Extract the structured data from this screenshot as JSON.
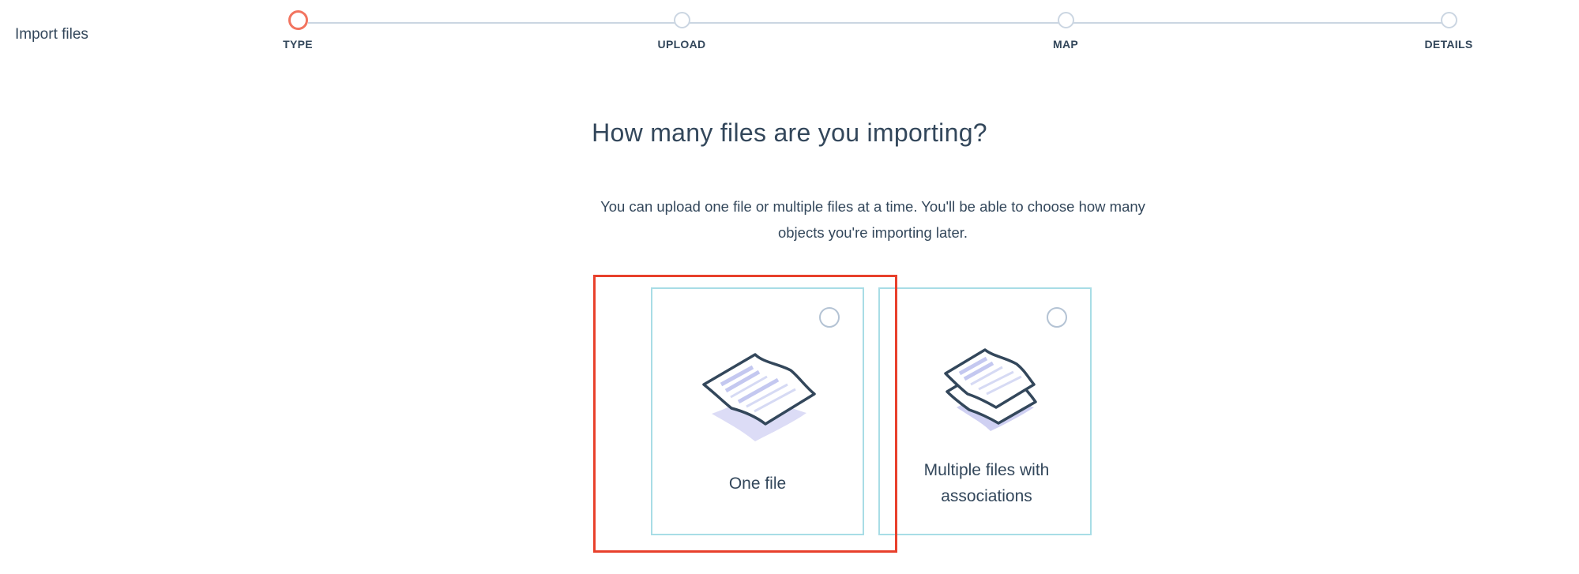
{
  "header": {
    "title": "Import files"
  },
  "stepper": {
    "steps": [
      {
        "label": "TYPE",
        "state": "active"
      },
      {
        "label": "UPLOAD",
        "state": "pending"
      },
      {
        "label": "MAP",
        "state": "pending"
      },
      {
        "label": "DETAILS",
        "state": "pending"
      }
    ],
    "active_color": "#f2745f",
    "inactive_color": "#cbd6e2"
  },
  "main": {
    "question": "How many files are you importing?",
    "description": "You can upload one file or multiple files at a time. You'll be able to choose how many objects you're importing later.",
    "options": [
      {
        "label": "One file",
        "selected": false,
        "icon": "single-file-illustration"
      },
      {
        "label": "Multiple files with associations",
        "selected": false,
        "icon": "multiple-files-illustration"
      }
    ]
  },
  "colors": {
    "text": "#33475b",
    "card_border": "#a8dde6",
    "highlight": "#e8402c"
  }
}
